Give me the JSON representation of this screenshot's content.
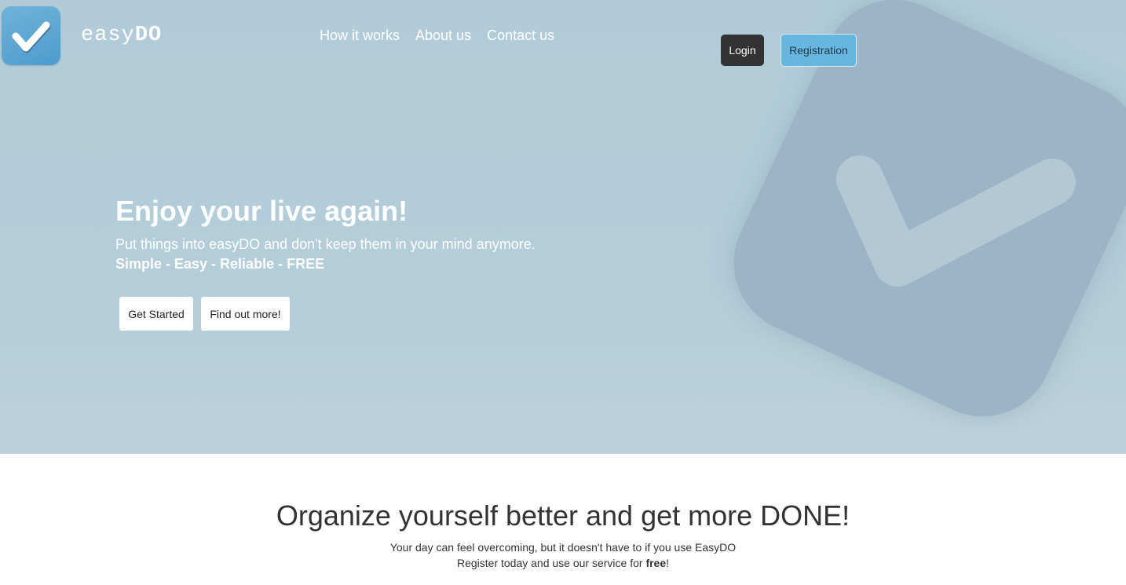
{
  "header": {
    "brand_light": "easy",
    "brand_bold": "DO",
    "nav": [
      {
        "label": "How it works"
      },
      {
        "label": "About us"
      },
      {
        "label": "Contact us"
      }
    ],
    "login_label": "Login",
    "register_label": "Registration"
  },
  "hero": {
    "title": "Enjoy your live again!",
    "subtitle": "Put things into easyDO and don't keep them in your mind anymore.",
    "tagline": "Simple - Easy - Reliable - FREE",
    "get_started_label": "Get Started",
    "find_out_label": "Find out more!"
  },
  "section": {
    "title": "Organize yourself better and get more DONE!",
    "line1": "Your day can feel overcoming, but it doesn't have to if you use EasyDO",
    "line2_prefix": "Register today and use our service for ",
    "line2_bold": "free",
    "line2_suffix": "!"
  },
  "icons": {
    "logo": "check-icon",
    "background": "check-icon"
  },
  "colors": {
    "hero_bg": "#b1ccd8",
    "badge": "#9db4c6",
    "login_bg": "#333333",
    "register_bg": "#66b6e0"
  }
}
